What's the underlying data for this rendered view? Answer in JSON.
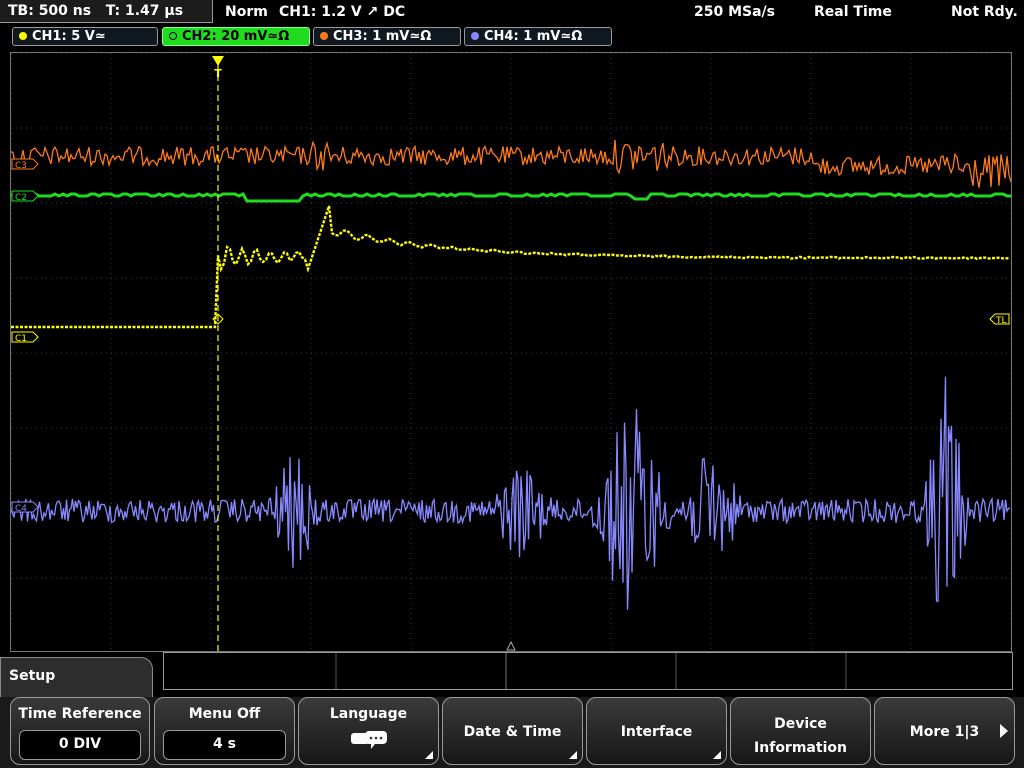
{
  "status": {
    "timebase": "TB: 500 ns   T: 1.47 µs",
    "trigger_mode": "Norm",
    "trigger_info": "CH1: 1.2 V ↗ DC",
    "sample_rate": "250 MSa/s",
    "acq_mode": "Real Time",
    "ready_state": "Not Rdy."
  },
  "channels": [
    {
      "label": "CH1: 5 V≃",
      "color": "#ffff00",
      "active": false
    },
    {
      "label": "CH2: 20 mV≃Ω",
      "color": "#1fdc1f",
      "active": true
    },
    {
      "label": "CH3: 1 mV≃Ω",
      "color": "#ff7a1a",
      "active": false
    },
    {
      "label": "CH4: 1 mV≃Ω",
      "color": "#8888ff",
      "active": false
    }
  ],
  "markers": {
    "c3": "C3",
    "c2": "C2",
    "c1": "C1",
    "c4": "C4",
    "trigger_level": "TL",
    "trigger_pos": "T"
  },
  "menu": {
    "title": "Setup",
    "keys": [
      {
        "title": "Time Reference",
        "value": "0 DIV"
      },
      {
        "title": "Menu Off",
        "value": "4 s"
      },
      {
        "title": "Language",
        "icon": "language-chat-icon"
      },
      {
        "title": "Date & Time"
      },
      {
        "title": "Interface"
      },
      {
        "title": "Device",
        "title2": "Information"
      },
      {
        "title": "More 1|3"
      }
    ]
  },
  "trace_colors": {
    "ch1": "#ffff00",
    "ch2": "#1fdc1f",
    "ch3": "#ff7a1a",
    "ch4": "#8888ff",
    "trigger": "#ffff00",
    "grid": "#3a3a3a"
  }
}
